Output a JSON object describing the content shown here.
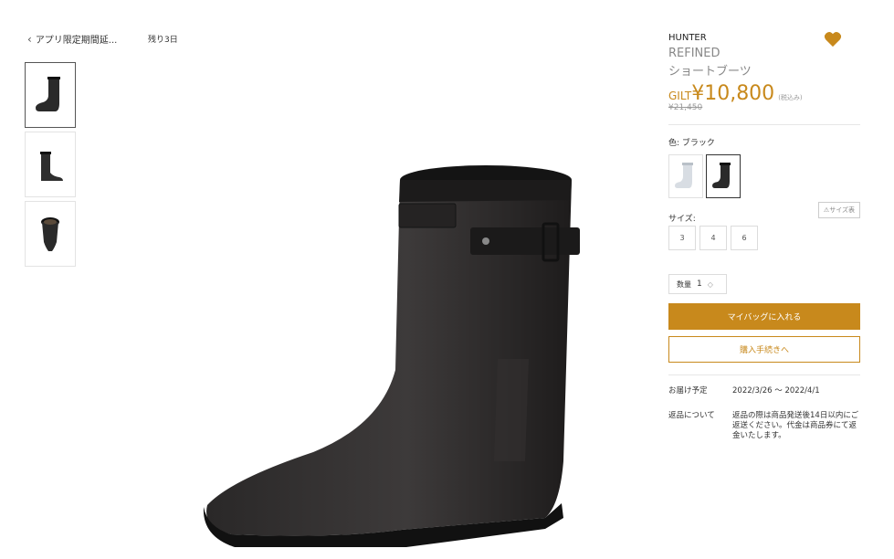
{
  "nav": {
    "back_label": "アプリ限定期間延...",
    "remaining": "残り3日"
  },
  "product": {
    "brand": "HUNTER",
    "name_line1": "REFINED",
    "name_line2": "ショートブーツ",
    "price_prefix": "GILT",
    "price": "¥10,800",
    "tax_note": "(税込み)",
    "original_price": "¥21,450",
    "color_label": "色: ブラック",
    "size_label": "サイズ:",
    "size_chart_label": "⚠サイズ表",
    "sizes": [
      "3",
      "4",
      "6"
    ],
    "quantity_label": "数量",
    "quantity_value": "1",
    "add_to_bag_label": "マイバッグに入れる",
    "checkout_label": "購入手続きへ",
    "delivery_key": "お届け予定",
    "delivery_value": "2022/3/26 〜 2022/4/1",
    "returns_key": "返品について",
    "returns_value": "返品の際は商品発送後14日以内にご返送ください。代金は商品券にて返金いたします。"
  },
  "colors": {
    "accent": "#c8891c",
    "text": "#333333",
    "muted": "#888888"
  }
}
